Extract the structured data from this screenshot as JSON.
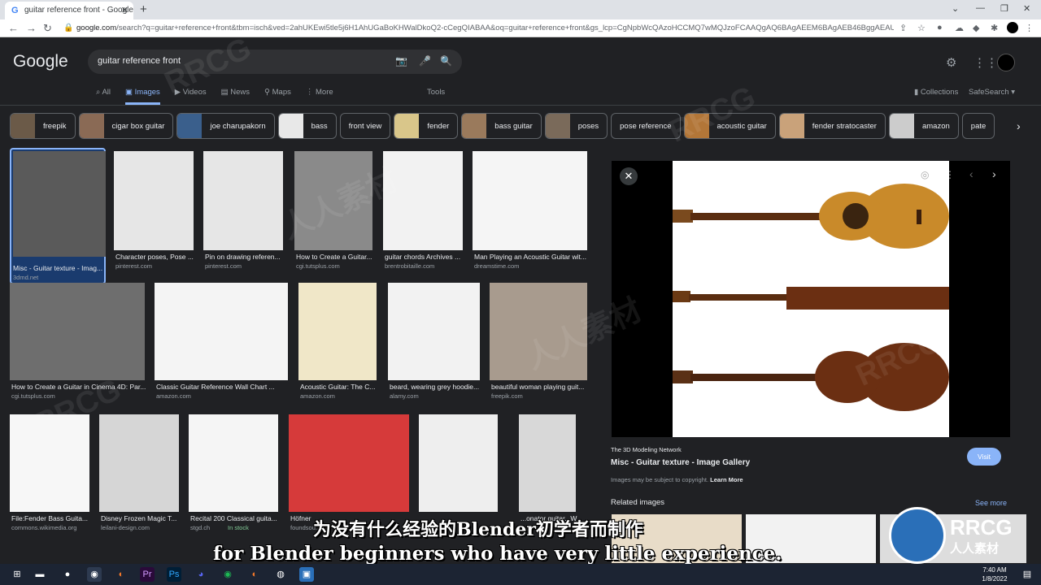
{
  "browser": {
    "tab_title": "guitar reference front - Google S",
    "url_host": "google.com",
    "url_path": "/search?q=guitar+reference+front&tbm=isch&ved=2ahUKEwi5tle5j6H1AhUGaBoKHWalDkoQ2-cCegQIABAA&oq=guitar+reference+front&gs_lcp=CgNpbWcQAzoHCCMQ7wMQJzoFCAAQgAQ6BAgAEEM6BAgAEB46BggAEAUQHI..."
  },
  "google": {
    "logo": "Google",
    "query": "guitar reference front",
    "nav_tabs": [
      {
        "label": "All",
        "icon": "search-icon"
      },
      {
        "label": "Images",
        "icon": "image-icon"
      },
      {
        "label": "Videos",
        "icon": "video-icon"
      },
      {
        "label": "News",
        "icon": "news-icon"
      },
      {
        "label": "Maps",
        "icon": "map-pin-icon"
      },
      {
        "label": "More",
        "icon": "more-icon"
      }
    ],
    "tools": "Tools",
    "collections": "Collections",
    "safesearch": "SafeSearch"
  },
  "chips": [
    {
      "label": "freepik",
      "thumb": "#6b5a48"
    },
    {
      "label": "cigar box guitar",
      "thumb": "#8a6a55"
    },
    {
      "label": "joe charupakorn",
      "thumb": "#3a5f8c"
    },
    {
      "label": "bass",
      "thumb": "#e8e8e8"
    },
    {
      "label": "front view",
      "thumb": ""
    },
    {
      "label": "fender",
      "thumb": "#d9c68a"
    },
    {
      "label": "bass guitar",
      "thumb": "#9a7a5c"
    },
    {
      "label": "poses",
      "thumb": "#7a6a5a"
    },
    {
      "label": "pose reference",
      "thumb": ""
    },
    {
      "label": "acoustic guitar",
      "thumb": "#b27638"
    },
    {
      "label": "fender stratocaster",
      "thumb": "#c9a27a"
    },
    {
      "label": "amazon",
      "thumb": "#ccc"
    },
    {
      "label": "pate",
      "thumb": ""
    }
  ],
  "results": [
    {
      "title": "Misc - Guitar texture - Imag...",
      "source": "3dmd.net",
      "color": "#5a5a5a"
    },
    {
      "title": "Character poses, Pose ...",
      "source": "pinterest.com",
      "color": "#e6e6e6"
    },
    {
      "title": "Pin on drawing referen...",
      "source": "pinterest.com",
      "color": "#e6e6e6"
    },
    {
      "title": "How to Create a Guitar...",
      "source": "cgi.tutsplus.com",
      "color": "#8a8a8a"
    },
    {
      "title": "guitar chords Archives ...",
      "source": "brentrobitaille.com",
      "color": "#f2f2f2"
    },
    {
      "title": "Man Playing an Acoustic Guitar wit...",
      "source": "dreamstime.com",
      "color": "#f5f5f5"
    },
    {
      "title": "How to Create a Guitar in Cinema 4D: Par...",
      "source": "cgi.tutsplus.com",
      "color": "#6e6e6e"
    },
    {
      "title": "Classic Guitar Reference Wall Chart ...",
      "source": "amazon.com",
      "color": "#f4f4f4"
    },
    {
      "title": "Acoustic Guitar: The C...",
      "source": "amazon.com",
      "color": "#f0e7c8"
    },
    {
      "title": "beard, wearing grey hoodie...",
      "source": "alamy.com",
      "color": "#f2f2f2"
    },
    {
      "title": "beautiful woman playing guit...",
      "source": "freepik.com",
      "color": "#a89b8e"
    },
    {
      "title": "File:Fender Bass Guita...",
      "source": "commons.wikimedia.org",
      "color": "#f7f7f7"
    },
    {
      "title": "Disney Frozen Magic T...",
      "source": "leilani-design.com",
      "color": "#d6d6d6"
    },
    {
      "title": "Recital 200 Classical guita...",
      "source": "stgd.ch",
      "stock": "In stock",
      "color": "#f5f5f5"
    },
    {
      "title": "Höfner",
      "source": "foundsou...",
      "color": "#d63a3a"
    },
    {
      "title": "",
      "source": "",
      "color": "#eeeeee"
    },
    {
      "title": "...onator guitar...Wiki",
      "source": "",
      "color": "#d8d8d8"
    }
  ],
  "preview": {
    "network": "The 3D Modeling Network",
    "title": "Misc - Guitar texture - Image Gallery",
    "copyright": "Images may be subject to copyright.",
    "learn_more": "Learn More",
    "visit": "Visit",
    "related": "Related images",
    "see_more": "See more"
  },
  "subtitles": {
    "cn": "为没有什么经验的Blender初学者而制作",
    "en": "for Blender beginners who have very little experience."
  },
  "watermark": {
    "brand": "RRCG",
    "brand_cn": "人人素材"
  },
  "taskbar": {
    "time": "7:40 AM",
    "date": "1/8/2022"
  },
  "colors": {
    "accent": "#8ab4f8",
    "background": "#202124",
    "guitar_body": "#c98a2a",
    "guitar_back": "#6b2f12"
  }
}
